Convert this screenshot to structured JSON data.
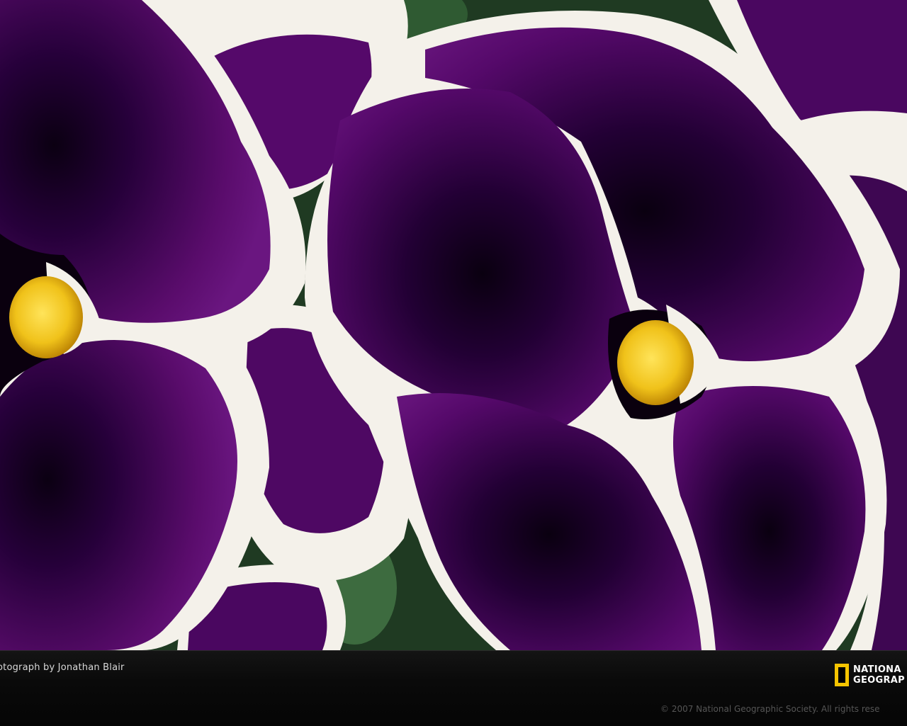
{
  "photo": {
    "subject": "purple-pansy-flowers",
    "colors": {
      "petal_purple": "#4a0a5a",
      "petal_dark": "#12001a",
      "petal_white": "#f4f1ea",
      "center_yellow": "#f0c21a",
      "leaf_green": "#2f5a32"
    }
  },
  "caption": {
    "credit": "otograph by Jonathan Blair",
    "copyright": "© 2007 National Geographic Society. All rights rese"
  },
  "logo": {
    "line1": "NATIONA",
    "line2": "GEOGRAP",
    "border_color": "#f5c400"
  }
}
